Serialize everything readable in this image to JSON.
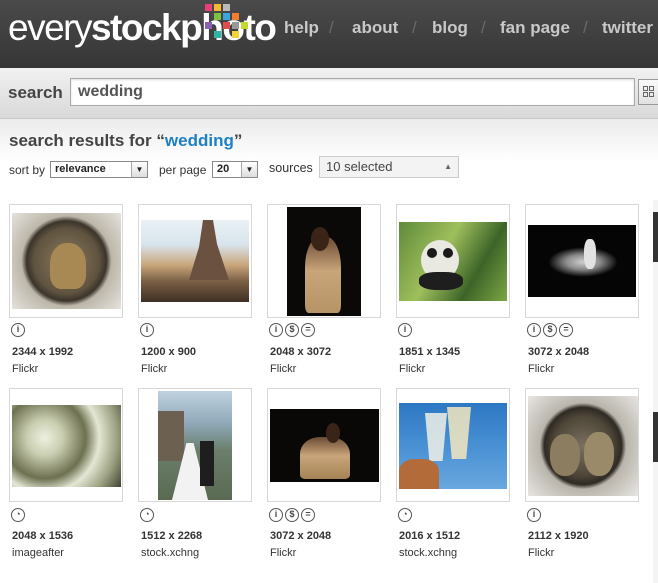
{
  "header": {
    "logo_light": "every",
    "logo_bold": "stockphoto",
    "nav": [
      "help",
      "about",
      "blog",
      "fan page",
      "twitter"
    ]
  },
  "search": {
    "label": "search",
    "value": "wedding"
  },
  "results": {
    "title_prefix": "search results for “",
    "query": "wedding",
    "title_suffix": "”"
  },
  "controls": {
    "sort_label": "sort by",
    "sort_value": "relevance",
    "per_page_label": "per page",
    "per_page_value": "20",
    "sources_label": "sources",
    "sources_value": "10 selected"
  },
  "items": [
    {
      "dims": "2344 x 1992",
      "source": "Flickr",
      "licenses": [
        "attribution"
      ]
    },
    {
      "dims": "1200 x 900",
      "source": "Flickr",
      "licenses": [
        "attribution"
      ]
    },
    {
      "dims": "2048 x 3072",
      "source": "Flickr",
      "licenses": [
        "attribution",
        "noncommercial",
        "noderivs"
      ]
    },
    {
      "dims": "1851 x 1345",
      "source": "Flickr",
      "licenses": [
        "attribution"
      ]
    },
    {
      "dims": "3072 x 2048",
      "source": "Flickr",
      "licenses": [
        "attribution",
        "noncommercial",
        "noderivs"
      ]
    },
    {
      "dims": "2048 x 1536",
      "source": "imageafter",
      "licenses": [
        "clock"
      ]
    },
    {
      "dims": "1512 x 2268",
      "source": "stock.xchng",
      "licenses": [
        "clock"
      ]
    },
    {
      "dims": "3072 x 2048",
      "source": "Flickr",
      "licenses": [
        "attribution",
        "noncommercial",
        "noderivs"
      ]
    },
    {
      "dims": "2016 x 1512",
      "source": "stock.xchng",
      "licenses": [
        "clock"
      ]
    },
    {
      "dims": "2112 x 1920",
      "source": "Flickr",
      "licenses": [
        "attribution"
      ]
    }
  ]
}
